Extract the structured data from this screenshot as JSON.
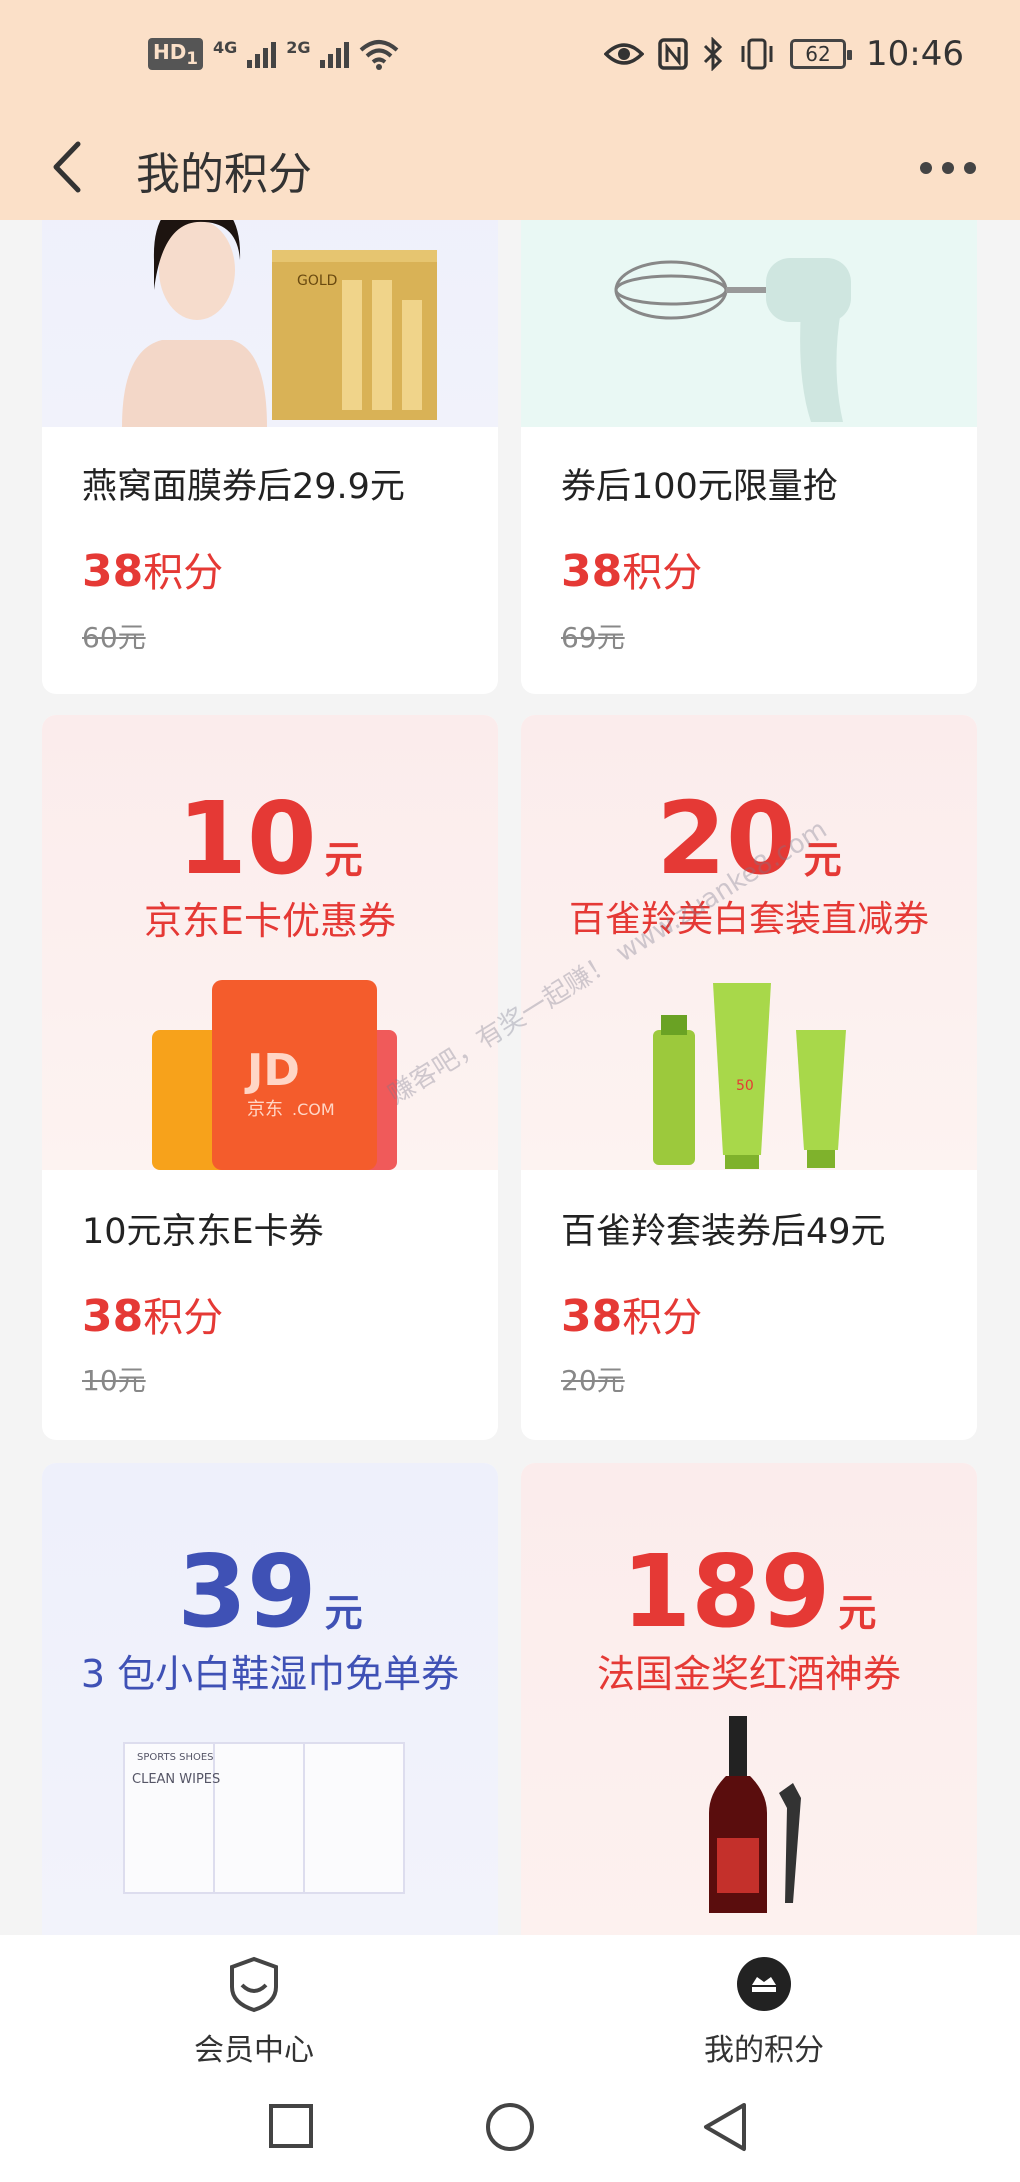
{
  "status_bar": {
    "hd": "HD",
    "hd_sub": "1",
    "net1": "4G",
    "net2": "2G",
    "battery": "62",
    "time": "10:46"
  },
  "header": {
    "title": "我的积分"
  },
  "colors": {
    "accent_red": "#e53935",
    "header_bg": "#fbe0c8",
    "blue": "#3f51b5"
  },
  "products": [
    {
      "name": "燕窝面膜券后29.9元",
      "points": "38",
      "points_unit": "积分",
      "original": "60元"
    },
    {
      "name": "券后100元限量抢",
      "points": "38",
      "points_unit": "积分",
      "original": "69元"
    },
    {
      "name": "10元京东E卡券",
      "points": "38",
      "points_unit": "积分",
      "original": "10元",
      "banner_amount": "10",
      "banner_unit": "元",
      "banner_text": "京东E卡优惠券"
    },
    {
      "name": "百雀羚套装券后49元",
      "points": "38",
      "points_unit": "积分",
      "original": "20元",
      "banner_amount": "20",
      "banner_unit": "元",
      "banner_text": "百雀羚美白套装直减券"
    },
    {
      "banner_amount": "39",
      "banner_unit": "元",
      "banner_text": "3 包小白鞋湿巾免单券"
    },
    {
      "banner_amount": "189",
      "banner_unit": "元",
      "banner_text": "法国金奖红酒神券"
    }
  ],
  "image_text": {
    "mask_box": "GOLD",
    "jd_card": "JD",
    "jd_card_sub": "京东",
    "jd_card_domain": ".COM",
    "wipes_brand": "SPORTS SHOES",
    "wipes_title": "CLEAN WIPES",
    "bottle_spf": "50"
  },
  "watermark": "赚客吧，有奖一起赚！ www.zuanke8.com",
  "bottom_nav": [
    {
      "label": "会员中心",
      "icon": "shield-face-icon"
    },
    {
      "label": "我的积分",
      "icon": "points-icon"
    }
  ],
  "system_nav": [
    "recent-apps-icon",
    "home-icon",
    "back-triangle-icon"
  ]
}
